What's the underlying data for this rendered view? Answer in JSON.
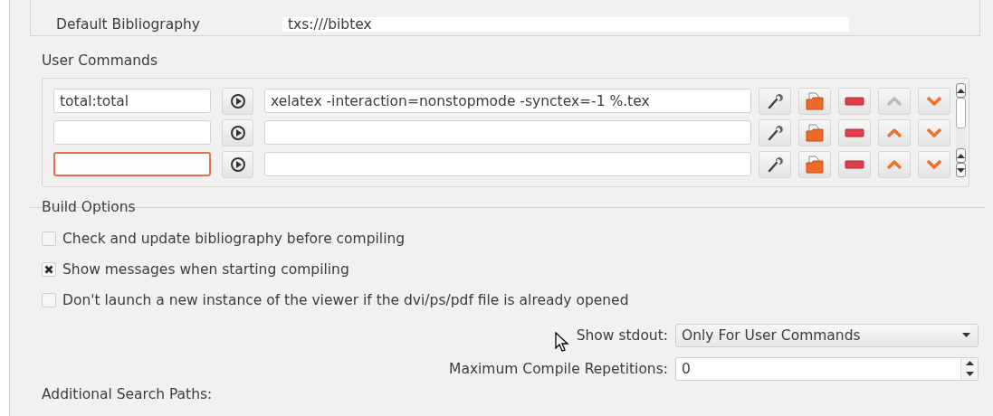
{
  "bibliography_row": {
    "label": "Default Bibliography",
    "value": "txs:///bibtex"
  },
  "user_commands": {
    "title": "User Commands",
    "rows": [
      {
        "name": "total:total",
        "command": "xelatex -interaction=nonstopmode -synctex=-1 %.tex",
        "focused": false,
        "up_disabled": true
      },
      {
        "name": "",
        "command": "",
        "focused": false,
        "up_disabled": false
      },
      {
        "name": "",
        "command": "",
        "focused": true,
        "up_disabled": false
      }
    ]
  },
  "build_options": {
    "title": "Build Options",
    "checkboxes": [
      {
        "label": "Check and update bibliography before compiling",
        "checked": false
      },
      {
        "label": "Show messages when starting compiling",
        "checked": true
      },
      {
        "label": "Don't launch a new instance of the viewer if the dvi/ps/pdf file is already opened",
        "checked": false
      }
    ],
    "show_stdout": {
      "label": "Show stdout:",
      "value": "Only For User Commands"
    },
    "max_repetitions": {
      "label": "Maximum Compile Repetitions:",
      "value": "0"
    },
    "search_paths_label": "Additional Search Paths:"
  }
}
